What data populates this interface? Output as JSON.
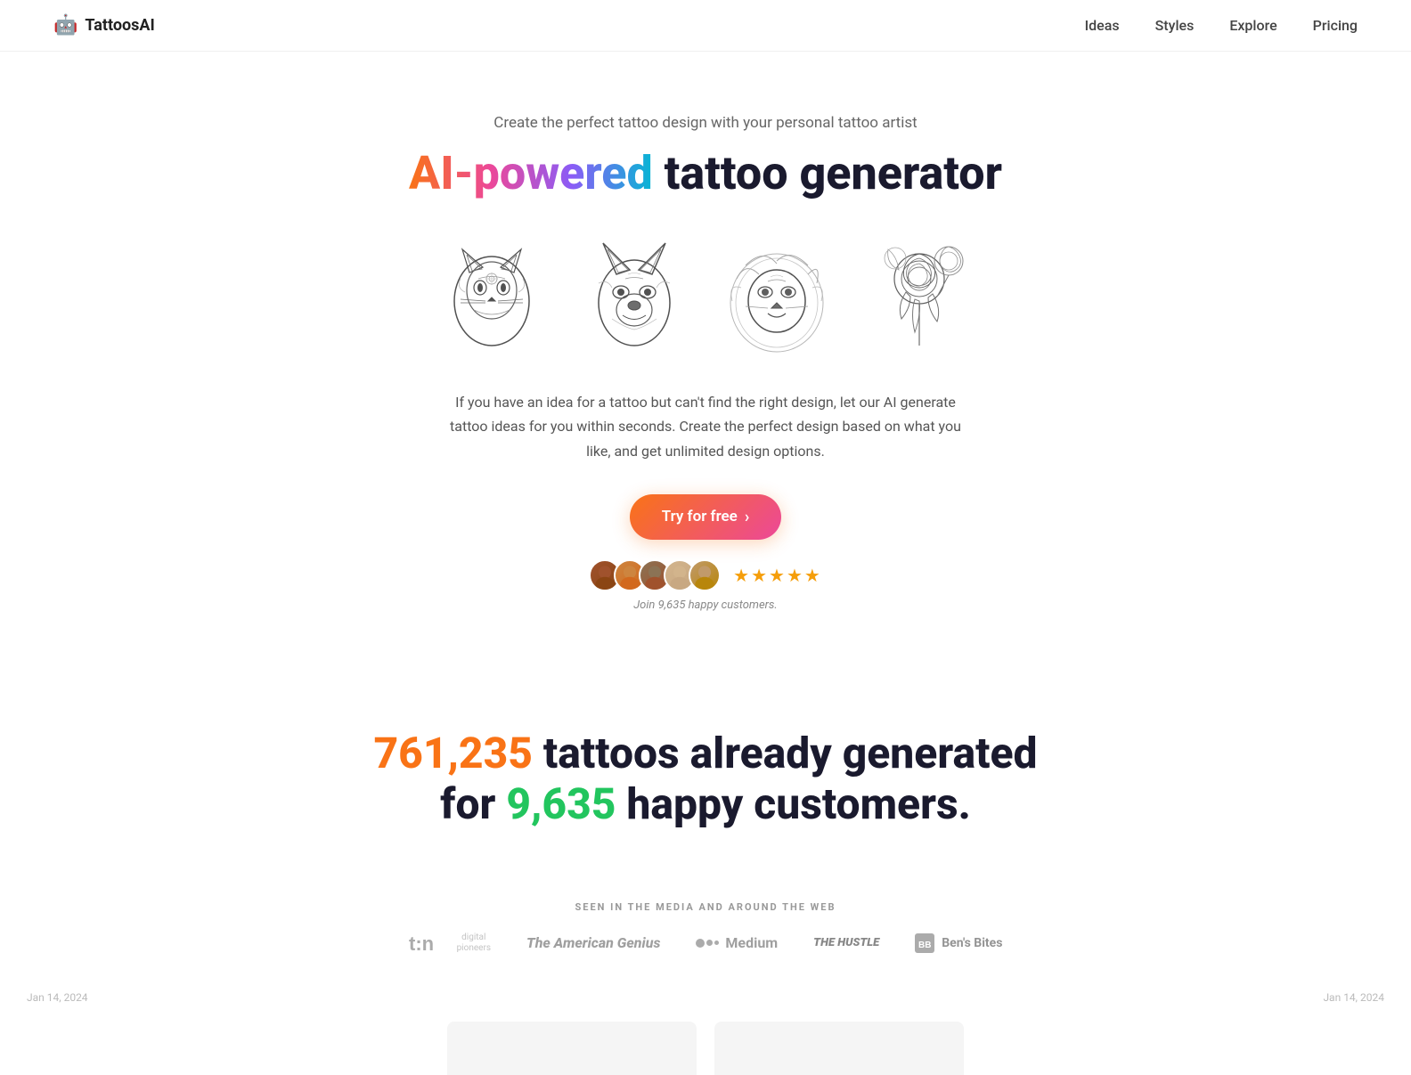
{
  "nav": {
    "logo_text": "TattoosAI",
    "logo_icon": "🤖",
    "links": [
      {
        "label": "Ideas",
        "href": "#"
      },
      {
        "label": "Styles",
        "href": "#"
      },
      {
        "label": "Explore",
        "href": "#"
      },
      {
        "label": "Pricing",
        "href": "#"
      }
    ]
  },
  "hero": {
    "subtitle": "Create the perfect tattoo design with your personal tattoo artist",
    "title_colored": "AI-powered",
    "title_rest": " tattoo generator",
    "description": "If you have an idea for a tattoo but can't find the right design, let our AI generate tattoo ideas for you within seconds. Create the perfect design based on what you like, and get unlimited design options.",
    "cta_label": "Try for free",
    "cta_arrow": "›",
    "social_text": "Join 9,635 happy customers.",
    "stars": "★★★★★"
  },
  "stats": {
    "number1": "761,235",
    "text1": " tattoos already generated",
    "text2": "for ",
    "number2": "9,635",
    "text3": " happy customers."
  },
  "media": {
    "label": "SEEN IN THE MEDIA AND AROUND THE WEB",
    "logos": [
      {
        "name": "TechNation",
        "display": "t:n digital pioneers"
      },
      {
        "name": "The American Genius",
        "display": "The American Genius"
      },
      {
        "name": "Medium",
        "display": "●●| Medium"
      },
      {
        "name": "The Hustle",
        "display": "the HUSTLE"
      },
      {
        "name": "Bens Bites",
        "display": "Ben's Bites"
      }
    ]
  },
  "bottom": {
    "date_left": "Jan 14, 2024",
    "date_right": "Jan 14, 2024"
  }
}
